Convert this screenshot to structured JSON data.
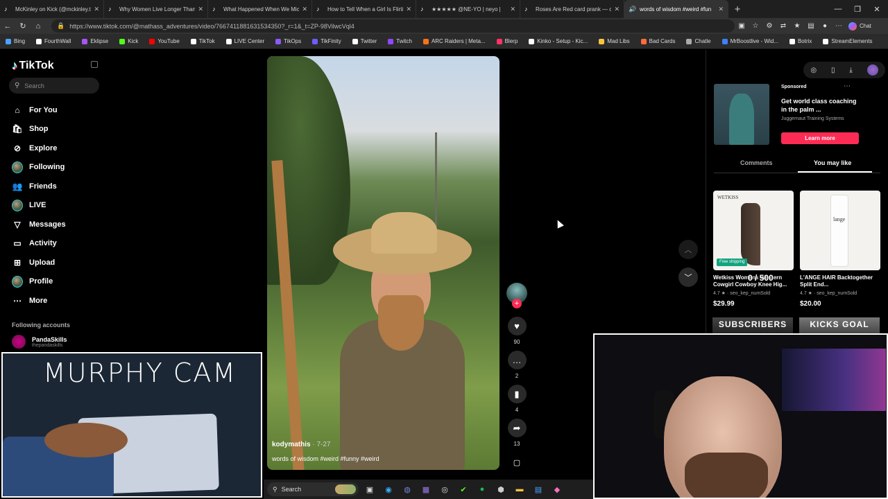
{
  "browser": {
    "tabs": [
      {
        "title": "McKinley on Kick (@mckinley.tv) |",
        "icon": "tiktok-icon",
        "active": false
      },
      {
        "title": "Why Women Live Longer Than Me",
        "icon": "tiktok-icon",
        "active": false
      },
      {
        "title": "What Happened When We Microw",
        "icon": "tiktok-icon",
        "active": false
      },
      {
        "title": "How to Tell When a Girl Is Flirting",
        "icon": "tiktok-icon",
        "active": false
      },
      {
        "title": "★★★★★ @NE-YO | neyo |",
        "icon": "tiktok-icon",
        "active": false
      },
      {
        "title": "Roses Are Red card prank — can y",
        "icon": "tiktok-icon",
        "active": false
      },
      {
        "title": "words of wisdom #weird #fun",
        "icon": "tiktok-icon",
        "active": true
      }
    ],
    "new_tab_label": "+",
    "url": "https://www.tiktok.com/@mathass_adventures/video/7667411881631534350?_r=1&_t=ZP-98VilwcVql4",
    "chat_label": "Chat",
    "bookmarks": [
      {
        "label": "Bing",
        "color": "#4aa3ff"
      },
      {
        "label": "FourthWall",
        "color": "#ffffff"
      },
      {
        "label": "Eklipse",
        "color": "#a855f7"
      },
      {
        "label": "Kick",
        "color": "#53fc18"
      },
      {
        "label": "YouTube",
        "color": "#ff0000"
      },
      {
        "label": "TikTok",
        "color": "#ffffff"
      },
      {
        "label": "LIVE Center",
        "color": "#ffffff"
      },
      {
        "label": "TikOps",
        "color": "#8a5cf6"
      },
      {
        "label": "TikFinity",
        "color": "#6d5dfc"
      },
      {
        "label": "Twitter",
        "color": "#ffffff"
      },
      {
        "label": "Twitch",
        "color": "#9146ff"
      },
      {
        "label": "ARC Raiders | Meta...",
        "color": "#f97316"
      },
      {
        "label": "Blerp",
        "color": "#ff3366"
      },
      {
        "label": "Kinko - Setup - Kic...",
        "color": "#ffffff"
      },
      {
        "label": "Mad Libs",
        "color": "#f5c542"
      },
      {
        "label": "Bad Cards",
        "color": "#ff6b3d"
      },
      {
        "label": "Chatle",
        "color": "#aaaaaa"
      },
      {
        "label": "MrBoostlive - Wid...",
        "color": "#3b82f6"
      },
      {
        "label": "Botrix",
        "color": "#ffffff"
      },
      {
        "label": "StreamElements",
        "color": "#ffffff"
      }
    ]
  },
  "tiktok": {
    "logo_text": "TikTok",
    "search_placeholder": "Search",
    "nav": [
      {
        "label": "For You",
        "icon": "home-icon"
      },
      {
        "label": "Shop",
        "icon": "shopping-bag-icon"
      },
      {
        "label": "Explore",
        "icon": "compass-icon"
      },
      {
        "label": "Following",
        "icon": "avatar-icon"
      },
      {
        "label": "Friends",
        "icon": "friends-icon"
      },
      {
        "label": "LIVE",
        "icon": "avatar-icon"
      },
      {
        "label": "Messages",
        "icon": "send-icon"
      },
      {
        "label": "Activity",
        "icon": "inbox-icon"
      },
      {
        "label": "Upload",
        "icon": "upload-icon"
      },
      {
        "label": "Profile",
        "icon": "avatar-icon"
      },
      {
        "label": "More",
        "icon": "more-icon"
      }
    ],
    "following_accounts_title": "Following accounts",
    "following_account": {
      "name": "PandaSkills",
      "handle": "thepandaskills"
    },
    "video": {
      "username": "kodymathis",
      "date": " · 7-27",
      "caption": "words of wisdom #weird #funny #weird"
    },
    "actions": {
      "likes": "90",
      "comments": "2",
      "saves": "4",
      "shares": "13"
    },
    "ad": {
      "sponsored_label": "Sponsored",
      "title": "Get world class coaching in the palm ...",
      "brand": "Juggernaut Training Systems",
      "cta": "Learn more"
    },
    "tabs": {
      "comments": "Comments",
      "you_may_like": "You may like"
    },
    "products": [
      {
        "brand": "WETKISS",
        "tag": "Free shipping",
        "name": "Wetkiss Womens Western Cowgirl Cowboy Knee Hig...",
        "rating": "4.7 ★ · seo_kep_numSold",
        "price": "$29.99"
      },
      {
        "brand": "lange",
        "tag": "",
        "name": "L'ANGE HAIR Backtogether Split End...",
        "rating": "4.7 ★ · seo_kep_numSold",
        "price": "$20.00"
      }
    ]
  },
  "overlays": {
    "murphy_cam_title": "MURPHY CAM",
    "goal_counter": "0 / 500",
    "subscribers_label": "SUBSCRIBERS",
    "kicks_goal_label": "KICKS GOAL"
  },
  "taskbar": {
    "search_label": "Search"
  }
}
